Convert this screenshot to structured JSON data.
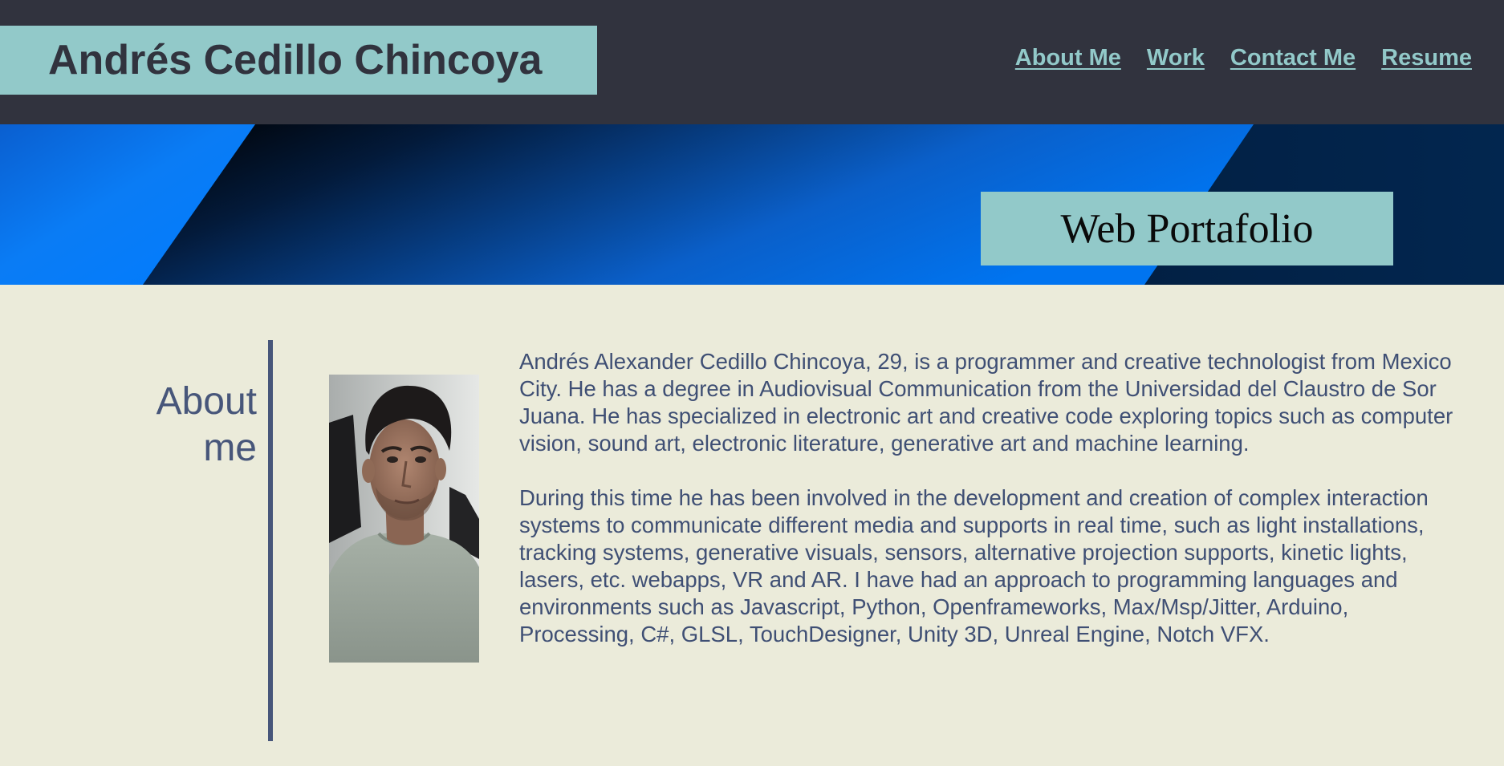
{
  "header": {
    "brand_name": "Andrés Cedillo Chincoya",
    "nav": [
      {
        "label": "About Me"
      },
      {
        "label": "Work"
      },
      {
        "label": "Contact Me"
      },
      {
        "label": "Resume"
      }
    ]
  },
  "banner": {
    "badge_text": "Web Portafolio"
  },
  "about": {
    "heading_line1": "About",
    "heading_line2": "me",
    "portrait_alt": "portrait photo",
    "paragraphs": [
      "Andrés Alexander Cedillo Chincoya, 29, is a programmer and creative technologist from Mexico City. He has a degree in Audiovisual Communication from the Universidad del Claustro de Sor Juana. He has specialized in electronic art and creative code exploring topics such as computer vision, sound art, electronic literature, generative art and machine learning.",
      "During this time he has been involved in the development and creation of complex interaction systems to communicate different media and supports in real time, such as light installations, tracking systems, generative visuals, sensors, alternative projection supports, kinetic lights, lasers, etc. webapps, VR and AR. I have had an approach to programming languages and environments such as Javascript, Python, Openframeworks, Max/Msp/Jitter, Arduino, Processing, C#, GLSL, TouchDesigner, Unity 3D, Unreal Engine, Notch VFX."
    ]
  },
  "colors": {
    "header_bg": "#31333e",
    "accent_teal": "#92c9c9",
    "page_bg": "#ebebda",
    "text_slate": "#47567a",
    "banner_blue": "#007bff",
    "banner_dark": "#001125"
  }
}
